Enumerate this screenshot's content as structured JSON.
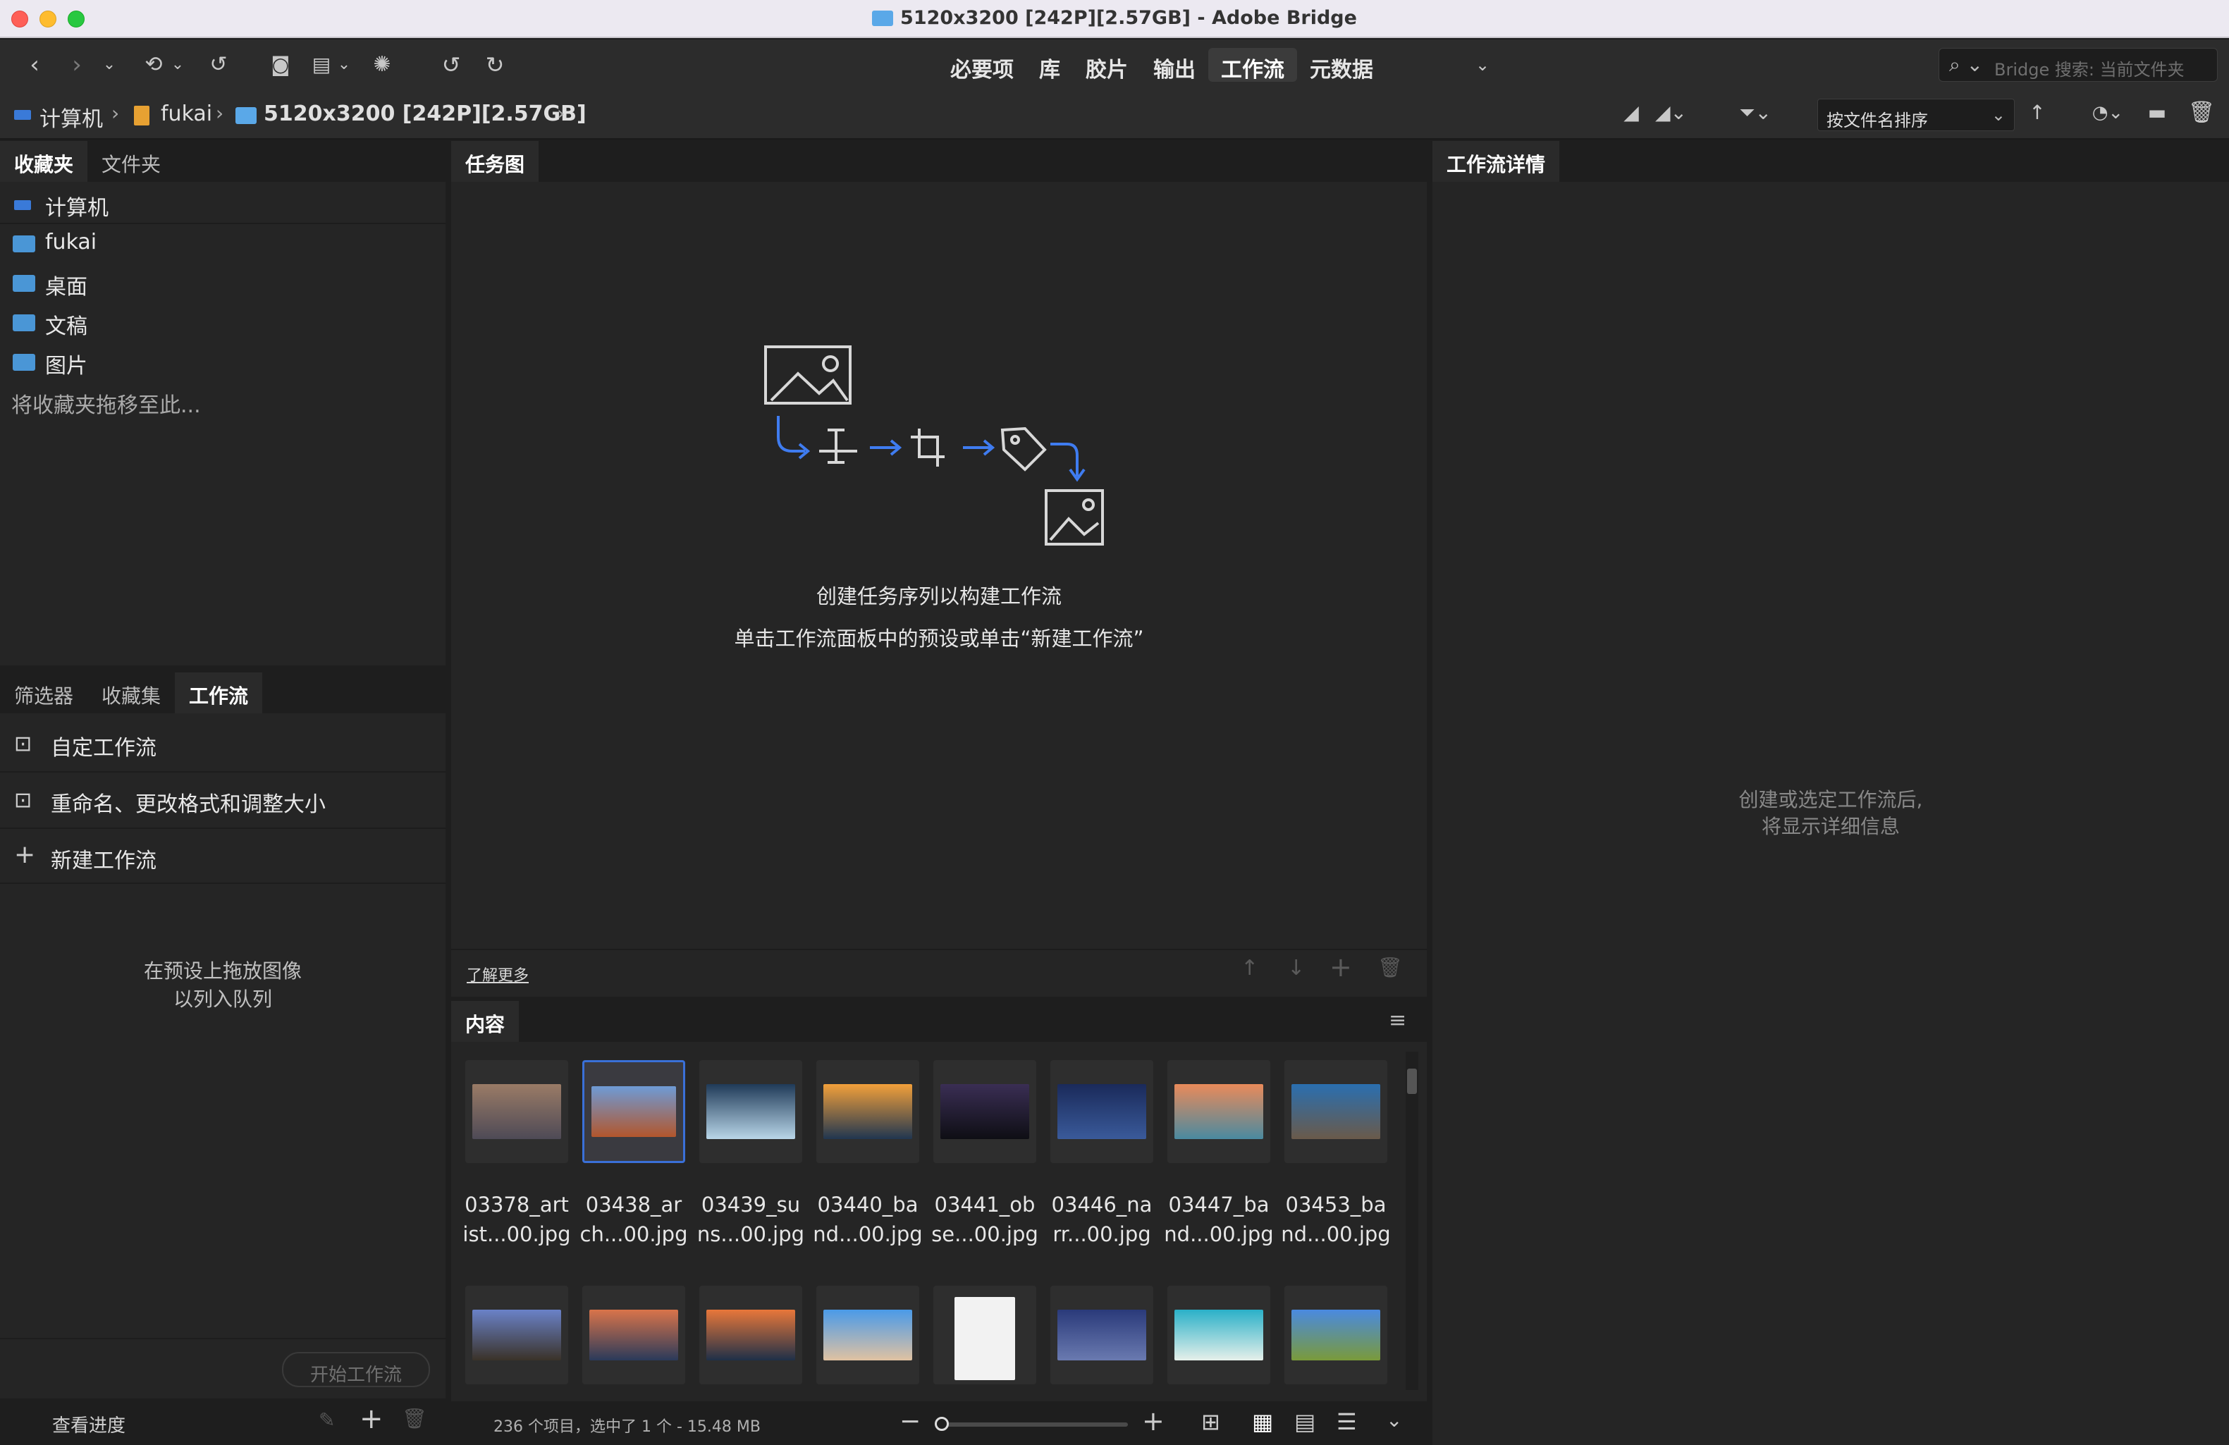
{
  "window": {
    "title": "5120x3200 [242P][2.57GB] - Adobe Bridge"
  },
  "toolbar": {
    "workspaces": [
      "必要项",
      "库",
      "胶片",
      "输出",
      "工作流",
      "元数据"
    ],
    "active_workspace": "工作流",
    "search_placeholder": "Bridge 搜索: 当前文件夹"
  },
  "path": {
    "items": [
      "计算机",
      "fukai",
      "5120x3200 [242P][2.57GB]"
    ]
  },
  "sort": {
    "label": "按文件名排序"
  },
  "favorites_panel": {
    "tabs": [
      "收藏夹",
      "文件夹"
    ],
    "items": [
      "计算机",
      "fukai",
      "桌面",
      "文稿",
      "图片"
    ],
    "drop_hint": "将收藏夹拖移至此..."
  },
  "workflow_panel": {
    "tabs": [
      "筛选器",
      "收藏集",
      "工作流"
    ],
    "items": [
      "自定工作流",
      "重命名、更改格式和调整大小"
    ],
    "new_label": "新建工作流",
    "hint_line1": "在预设上拖放图像",
    "hint_line2": "以列入队列",
    "start_button": "开始工作流",
    "view_progress": "查看进度"
  },
  "taskmap_panel": {
    "tab": "任务图",
    "line1": "创建任务序列以构建工作流",
    "line2": "单击工作流面板中的预设或单击“新建工作流”",
    "learn_more": "了解更多"
  },
  "details_panel": {
    "tab": "工作流详情",
    "hint_line1": "创建或选定工作流后,",
    "hint_line2": "将显示详细信息"
  },
  "content_panel": {
    "tab": "内容",
    "files": [
      {
        "line1": "03378_art",
        "line2": "ist...00.jpg",
        "c1": "#9a7b66",
        "c2": "#4e4a56"
      },
      {
        "line1": "03438_ar",
        "line2": "ch...00.jpg",
        "c1": "#6e9bd6",
        "c2": "#b2562c"
      },
      {
        "line1": "03439_su",
        "line2": "ns...00.jpg",
        "c1": "#1f3a58",
        "c2": "#b9d6e8"
      },
      {
        "line1": "03440_ba",
        "line2": "nd...00.jpg",
        "c1": "#f2a03a",
        "c2": "#203650"
      },
      {
        "line1": "03441_ob",
        "line2": "se...00.jpg",
        "c1": "#3a2e54",
        "c2": "#0e0e14"
      },
      {
        "line1": "03446_na",
        "line2": "rr...00.jpg",
        "c1": "#1a2a5a",
        "c2": "#3a5a9a"
      },
      {
        "line1": "03447_ba",
        "line2": "nd...00.jpg",
        "c1": "#e98a5a",
        "c2": "#4a8aa0"
      },
      {
        "line1": "03453_ba",
        "line2": "nd...00.jpg",
        "c1": "#2a6fb0",
        "c2": "#6a5a4a"
      }
    ],
    "row2_colors": [
      [
        "#6a82c8",
        "#3a3228"
      ],
      [
        "#d9744a",
        "#2a3a5a"
      ],
      [
        "#e8773a",
        "#1e3048"
      ],
      [
        "#4a9ae8",
        "#e0c2a2"
      ],
      [
        "#ffffff",
        "#ffffff"
      ],
      [
        "#2a3a7a",
        "#6a7ab0"
      ],
      [
        "#2ab0c8",
        "#e6f0ea"
      ],
      [
        "#4a8ae0",
        "#7a9a3a"
      ]
    ],
    "status": "236 个项目，选中了 1 个 - 15.48 MB"
  }
}
